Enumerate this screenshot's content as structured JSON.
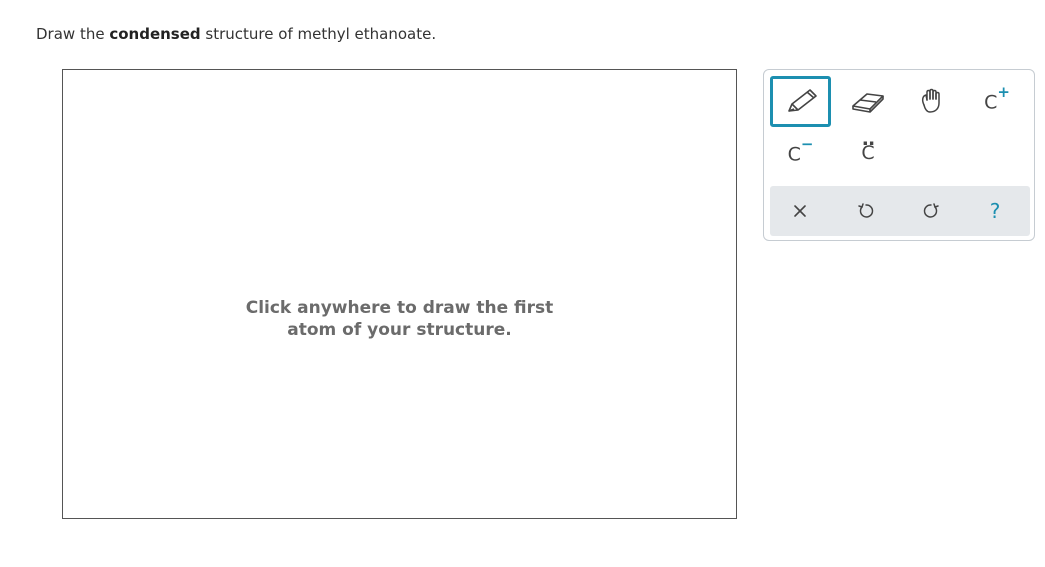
{
  "question": {
    "prefix": "Draw the ",
    "bold": "condensed",
    "suffix": " structure of methyl ethanoate."
  },
  "canvas": {
    "hint_line1": "Click anywhere to draw the first",
    "hint_line2": "atom of your structure."
  },
  "toolbar": {
    "tools": [
      {
        "name": "pencil",
        "icon": "pencil-icon",
        "selected": true
      },
      {
        "name": "eraser",
        "icon": "eraser-icon"
      },
      {
        "name": "move",
        "icon": "hand-icon"
      },
      {
        "name": "positive-charge",
        "label": "C",
        "superscript": "+"
      },
      {
        "name": "negative-charge",
        "label": "C",
        "superscript": "−"
      },
      {
        "name": "lone-pair",
        "label": "C",
        "dots": ":"
      }
    ],
    "actions": [
      {
        "name": "clear",
        "icon": "close-icon"
      },
      {
        "name": "undo",
        "icon": "undo-icon"
      },
      {
        "name": "redo",
        "icon": "redo-icon"
      },
      {
        "name": "help",
        "label": "?"
      }
    ]
  },
  "colors": {
    "accent": "#1c8fb0",
    "action_bar": "#e5e8eb",
    "hint_text": "#6b6b6b"
  }
}
